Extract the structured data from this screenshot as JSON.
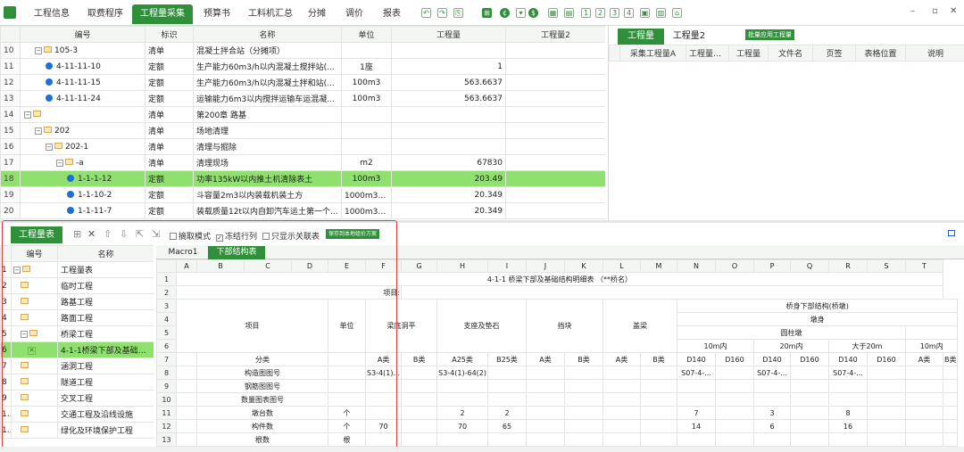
{
  "topbar": {
    "tabs": [
      "工程信息",
      "取费程序",
      "工程量采集",
      "预算书",
      "工料机汇总",
      "分摊",
      "调价",
      "报表"
    ],
    "active_tab": "工程量采集",
    "numbered_buttons": [
      "1",
      "2",
      "3",
      "4"
    ],
    "window_controls": [
      "–",
      "▫",
      "✕"
    ]
  },
  "upper": {
    "columns": [
      "编号",
      "标识",
      "名称",
      "单位",
      "工程量",
      "工程量2"
    ],
    "rows": [
      {
        "n": "10",
        "code": "105-3",
        "type": "清单",
        "name": "混凝土拌合站（分摊项）",
        "unit": "",
        "qty": "",
        "icon": "folder",
        "indent": 1,
        "pm": "−"
      },
      {
        "n": "11",
        "code": "4-11-11-10",
        "type": "定额",
        "name": "生产能力60m3/h以内混凝土搅拌站(...",
        "unit": "1座",
        "qty": "1",
        "icon": "dot",
        "indent": 2,
        "pm": ""
      },
      {
        "n": "12",
        "code": "4-11-11-15",
        "type": "定额",
        "name": "生产能力60m3/h以内混凝土拌和站(...",
        "unit": "100m3",
        "qty": "563.6637",
        "icon": "dot",
        "indent": 2,
        "pm": ""
      },
      {
        "n": "13",
        "code": "4-11-11-24",
        "type": "定额",
        "name": "运输能力6m3以内搅拌运输车运混凝...",
        "unit": "100m3",
        "qty": "563.6637",
        "icon": "dot",
        "indent": 2,
        "pm": ""
      },
      {
        "n": "14",
        "code": "",
        "type": "清单",
        "name": "第200章 路基",
        "unit": "",
        "qty": "",
        "icon": "folder",
        "indent": 0,
        "pm": "−"
      },
      {
        "n": "15",
        "code": "202",
        "type": "清单",
        "name": "场地清理",
        "unit": "",
        "qty": "",
        "icon": "folder",
        "indent": 1,
        "pm": "−"
      },
      {
        "n": "16",
        "code": "202-1",
        "type": "清单",
        "name": "清理与掘除",
        "unit": "",
        "qty": "",
        "icon": "folder",
        "indent": 2,
        "pm": "−"
      },
      {
        "n": "17",
        "code": "-a",
        "type": "清单",
        "name": "清理现场",
        "unit": "m2",
        "qty": "67830",
        "icon": "folder",
        "indent": 3,
        "pm": "−"
      },
      {
        "n": "18",
        "code": "1-1-1-12",
        "type": "定额",
        "name": "功率135kW以内推土机清除表土",
        "unit": "100m3",
        "qty": "203.49",
        "icon": "dot",
        "indent": 4,
        "pm": "",
        "selected": true
      },
      {
        "n": "19",
        "code": "1-1-10-2",
        "type": "定额",
        "name": "斗容量2m3以内装载机装土方",
        "unit": "1000m3天...",
        "qty": "20.349",
        "icon": "dot",
        "indent": 4,
        "pm": ""
      },
      {
        "n": "20",
        "code": "1-1-11-7",
        "type": "定额",
        "name": "装载质量12t以内自卸汽车运土第一个...",
        "unit": "1000m3天...",
        "qty": "20.349",
        "icon": "dot",
        "indent": 4,
        "pm": ""
      }
    ]
  },
  "right": {
    "tabs": [
      "工程量",
      "工程量2"
    ],
    "batch_button": "批量应用工程量",
    "columns": [
      "采集工程量A",
      "工程量换...",
      "工程量",
      "文件名",
      "页签",
      "表格位置",
      "说明"
    ]
  },
  "lower": {
    "tab": "工程量表",
    "toolbar_checks": [
      {
        "label": "摘取模式",
        "checked": false
      },
      {
        "label": "冻结行列",
        "checked": true
      },
      {
        "label": "只显示关联表",
        "checked": false
      }
    ],
    "save_button": "保存到本地组价方案",
    "list_columns": [
      "编号",
      "名称"
    ],
    "list": [
      {
        "n": "1",
        "name": "工程量表",
        "pm": "−",
        "indent": 0
      },
      {
        "n": "2",
        "name": "临时工程",
        "pm": "",
        "indent": 1
      },
      {
        "n": "3",
        "name": "路基工程",
        "pm": "",
        "indent": 1
      },
      {
        "n": "4",
        "name": "路面工程",
        "pm": "",
        "indent": 1
      },
      {
        "n": "5",
        "name": "桥梁工程",
        "pm": "−",
        "indent": 1
      },
      {
        "n": "6",
        "name": "4-1-1桥梁下部及基础结...",
        "pm": "",
        "indent": 2,
        "selected": true,
        "xicon": true
      },
      {
        "n": "7",
        "name": "涵洞工程",
        "pm": "",
        "indent": 1
      },
      {
        "n": "8",
        "name": "隧道工程",
        "pm": "",
        "indent": 1
      },
      {
        "n": "9",
        "name": "交叉工程",
        "pm": "",
        "indent": 1
      },
      {
        "n": "10",
        "name": "交通工程及沿线设施",
        "pm": "",
        "indent": 1
      },
      {
        "n": "11",
        "name": "绿化及环境保护工程",
        "pm": "",
        "indent": 1
      }
    ],
    "sheet_tabs": [
      "Macro1",
      "下部结构表"
    ],
    "sheet_cols": [
      "A",
      "B",
      "C",
      "D",
      "E",
      "F",
      "G",
      "H",
      "I",
      "J",
      "K",
      "L",
      "M",
      "N",
      "O",
      "P",
      "Q",
      "R",
      "S",
      "T"
    ],
    "sheet": {
      "title": "4-1-1 桥梁下部及基础结构明细表 （**桥名）",
      "project_label": "项目:",
      "item": "项目",
      "unit": "单位",
      "beam_bottom": "梁底洞平",
      "bearing": "支座及垫石",
      "stopper": "挡块",
      "cap": "盖梁",
      "pier_struct": "桥身下部结构(桥墩)",
      "pier_body": "墩身",
      "round_col": "圆柱墩",
      "within_10": "10m内",
      "within_20": "20m内",
      "over_20": "大于20m",
      "within_10b": "10m内",
      "r7": [
        "分类",
        "",
        "A类",
        "B类",
        "A25类",
        "B25类",
        "A类",
        "B类",
        "A类",
        "B类",
        "D140",
        "D160",
        "D140",
        "D160",
        "D140",
        "D160",
        "A类",
        "B类"
      ],
      "r8": [
        "构造图图号",
        "",
        "S3-4(1)...",
        "",
        "S3-4(1)-64(2)",
        "",
        "",
        "",
        "",
        "",
        "S07-4-...",
        "",
        "S07-4-...",
        "",
        "S07-4-...",
        "",
        "",
        ""
      ],
      "r9": [
        "钢筋图图号"
      ],
      "r10": [
        "数量图表图号"
      ],
      "r11": [
        "墩台数",
        "个",
        "",
        "",
        "2",
        "2",
        "",
        "",
        "",
        "",
        "7",
        "",
        "3",
        "",
        "8",
        "",
        "",
        ""
      ],
      "r12": [
        "构件数",
        "个",
        "70",
        "",
        "70",
        "65",
        "",
        "",
        "",
        "",
        "14",
        "",
        "6",
        "",
        "16",
        "",
        "",
        ""
      ],
      "r13": [
        "根数",
        "根"
      ]
    }
  }
}
